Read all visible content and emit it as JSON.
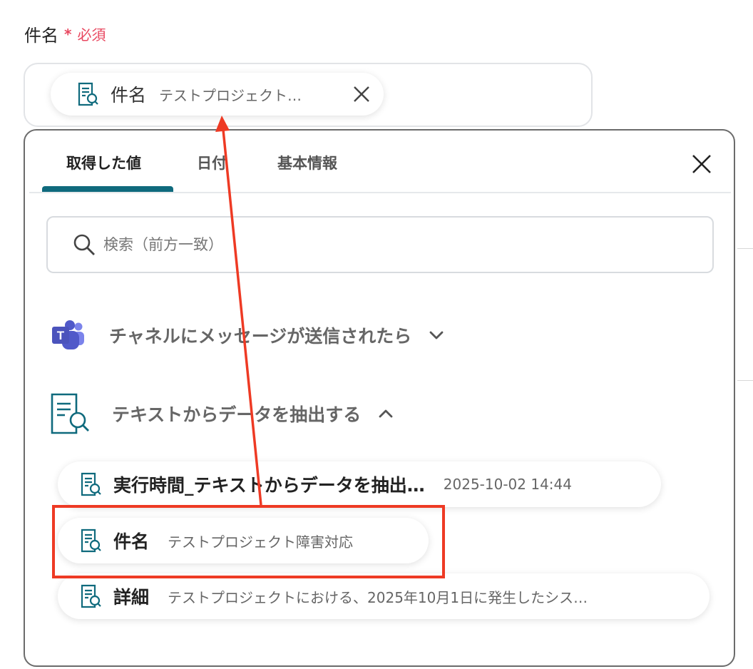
{
  "field": {
    "label": "件名",
    "required_mark": "*",
    "required_text": "必須",
    "chip": {
      "name": "件名",
      "value": "テストプロジェクト…",
      "icon": "document-search-icon",
      "remove_icon": "close-icon"
    }
  },
  "panel": {
    "tabs": [
      {
        "label": "取得した値"
      },
      {
        "label": "日付"
      },
      {
        "label": "基本情報"
      }
    ],
    "active_tab": "取得した値",
    "close_icon": "close-icon",
    "search": {
      "placeholder": "検索（前方一致）",
      "value": ""
    },
    "sections": [
      {
        "title": "チャネルにメッセージが送信されたら",
        "icon": "microsoft-teams-icon",
        "expanded": false
      },
      {
        "title": "テキストからデータを抽出する",
        "icon": "document-search-icon",
        "expanded": true,
        "items": [
          {
            "name": "実行時間_テキストからデータを抽出…",
            "value": "2025-10-02 14:44"
          },
          {
            "name": "件名",
            "value": "テストプロジェクト障害対応"
          },
          {
            "name": "詳細",
            "value": "テストプロジェクトにおける、2025年10月1日に発生したシス…"
          }
        ]
      }
    ]
  },
  "colors": {
    "accent": "#0f6a7d",
    "required": "#e8475f",
    "annotation": "#ee3a24"
  }
}
